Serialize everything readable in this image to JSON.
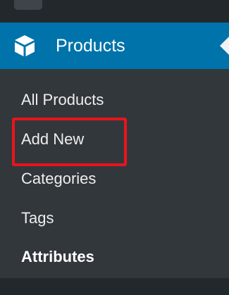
{
  "menu": {
    "header": {
      "label": "Products",
      "icon": "woocommerce-box-icon",
      "accent_color": "#0073aa"
    },
    "submenu": [
      {
        "label": "All Products",
        "current": false
      },
      {
        "label": "Add New",
        "current": false,
        "highlighted": true
      },
      {
        "label": "Categories",
        "current": false
      },
      {
        "label": "Tags",
        "current": false
      },
      {
        "label": "Attributes",
        "current": true
      }
    ]
  },
  "colors": {
    "sidebar_bg": "#32373c",
    "strip_bg": "#23282d",
    "highlight": "#e8151b",
    "text": "#eeeeee"
  }
}
